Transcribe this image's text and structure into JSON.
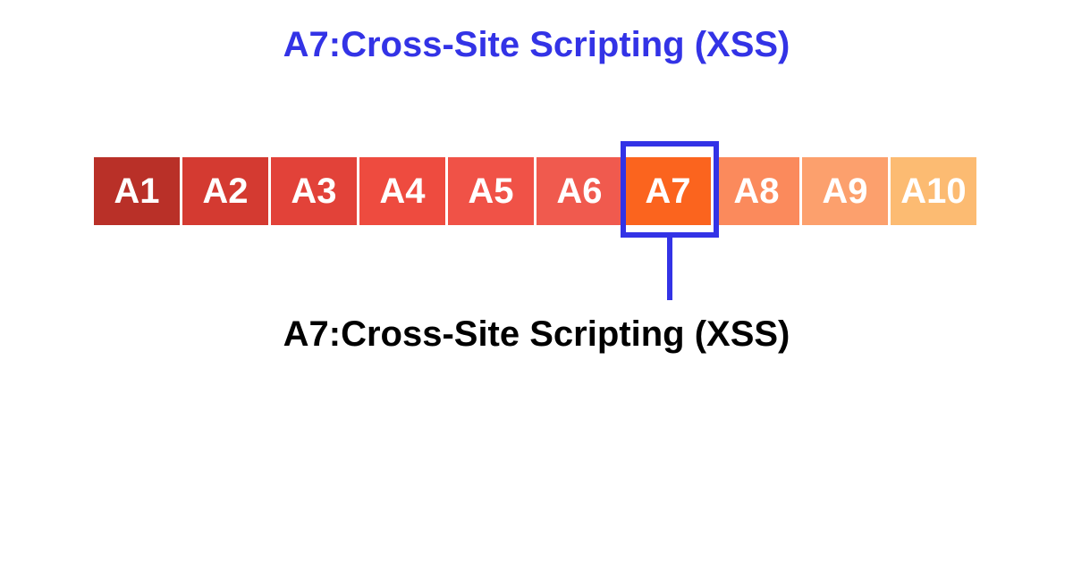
{
  "title": "A7:Cross-Site Scripting (XSS)",
  "caption": "A7:Cross-Site Scripting (XSS)",
  "colors": {
    "title": "#3333e6",
    "highlight": "#3333e6",
    "caption": "#000000"
  },
  "highlighted_index": 6,
  "cells": [
    {
      "label": "A1",
      "bg": "#b93028"
    },
    {
      "label": "A2",
      "bg": "#d43a31"
    },
    {
      "label": "A3",
      "bg": "#e24239"
    },
    {
      "label": "A4",
      "bg": "#ee4b3f"
    },
    {
      "label": "A5",
      "bg": "#f05247"
    },
    {
      "label": "A6",
      "bg": "#f05a4e"
    },
    {
      "label": "A7",
      "bg": "#fb641e"
    },
    {
      "label": "A8",
      "bg": "#fb8a5c"
    },
    {
      "label": "A9",
      "bg": "#fca06d"
    },
    {
      "label": "A10",
      "bg": "#fcbb72"
    }
  ]
}
